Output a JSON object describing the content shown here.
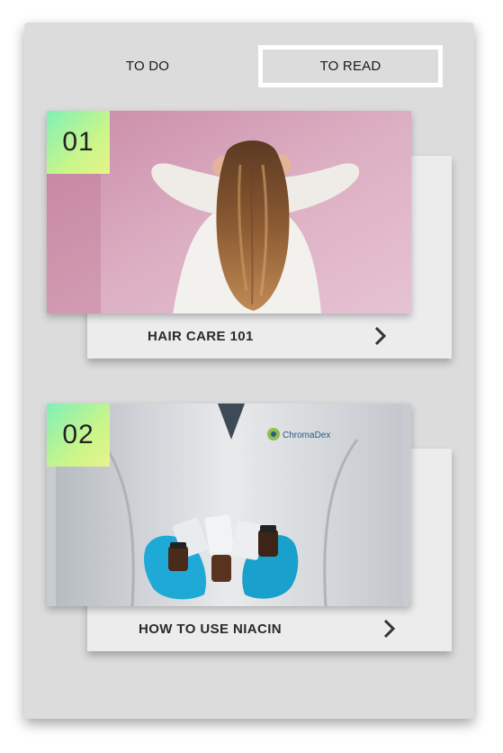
{
  "tabs": [
    {
      "label": "TO DO",
      "active": false
    },
    {
      "label": "TO READ",
      "active": true
    }
  ],
  "cards": [
    {
      "number": "01",
      "title": "HAIR CARE 101",
      "image": "woman-hair-photo"
    },
    {
      "number": "02",
      "title": "HOW TO USE NIACIN",
      "image": "lab-coat-bottles-photo",
      "logo_text": "ChromaDex"
    }
  ],
  "colors": {
    "panel": "#dcdcdc",
    "card": "#ececec",
    "badge_gradient_start": "#7ff0b8",
    "badge_gradient_end": "#e7f48a",
    "photo1_background": "#d9a9be",
    "glove": "#1fa9d6"
  },
  "icons": {
    "card_arrow": "chevron-right-icon"
  }
}
